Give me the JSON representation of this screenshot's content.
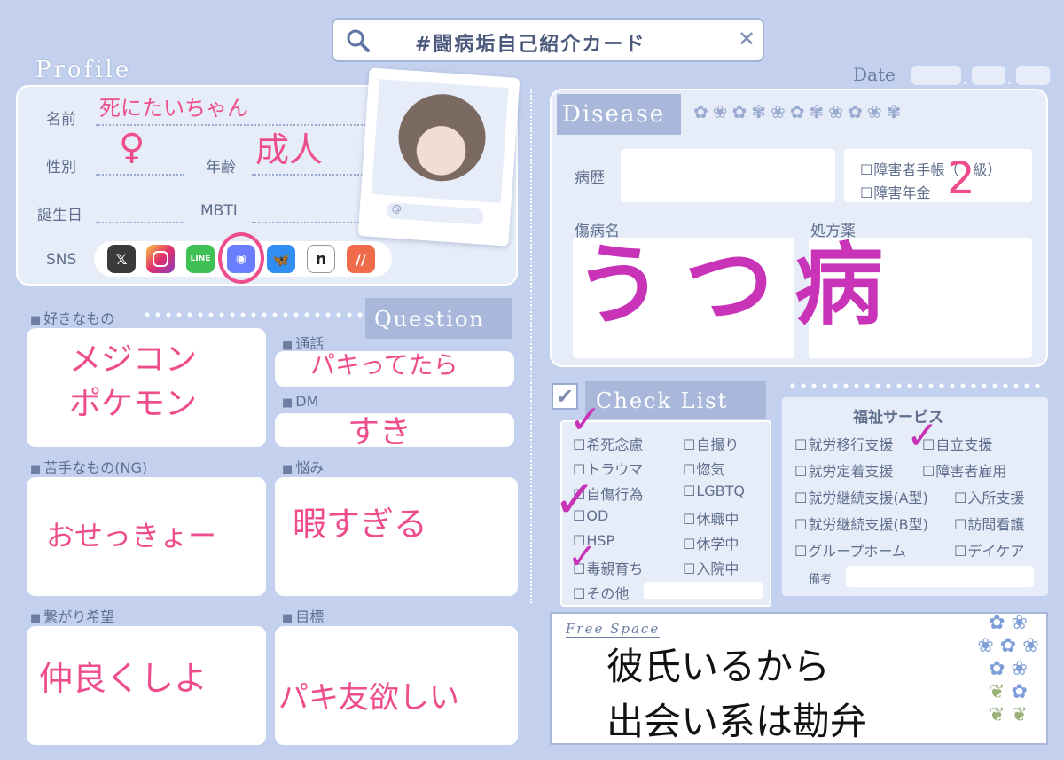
{
  "search": {
    "title": "#闘病垢自己紹介カード"
  },
  "date_label": "Date",
  "date_sep": ".",
  "profile": {
    "heading": "Profile",
    "name_label": "名前",
    "name_value": "死にたいちゃん",
    "sex_label": "性別",
    "sex_value": "♀",
    "age_label": "年齢",
    "age_value": "成人",
    "birthday_label": "誕生日",
    "mbti_label": "MBTI",
    "sns_label": "SNS",
    "photo_at": "@",
    "sns_icons": [
      "x-icon",
      "instagram-icon",
      "line-icon",
      "discord-icon",
      "bluesky-icon",
      "note-icon",
      "other-sns-icon"
    ]
  },
  "likes": {
    "label": "好きなもの",
    "lines": [
      "メジコン",
      "ポケモン"
    ]
  },
  "question_tag": "Question",
  "call": {
    "label": "通話",
    "value": "パキってたら"
  },
  "dm": {
    "label": "DM",
    "value": "すき"
  },
  "ng": {
    "label": "苦手なもの(NG)",
    "value": "おせっきょー"
  },
  "worry": {
    "label": "悩み",
    "value": "暇すぎる"
  },
  "connect": {
    "label": "繋がり希望",
    "value": "仲良くしよ"
  },
  "goal": {
    "label": "目標",
    "value": "パキ友欲しい"
  },
  "disease": {
    "heading": "Disease",
    "history_label": "病歴",
    "handbook": "障害者手帳（　級）",
    "handbook_grade": "2",
    "pension": "障害年金",
    "diagnosis_label": "傷病名",
    "diagnosis_value": "うつ病",
    "prescription_label": "処方薬"
  },
  "checklist": {
    "heading": "Check List",
    "col1": [
      "希死念慮",
      "トラウマ",
      "自傷行為",
      "OD",
      "HSP",
      "毒親育ち",
      "その他"
    ],
    "col2": [
      "自撮り",
      "惚気",
      "LGBTQ",
      "休職中",
      "休学中",
      "入院中"
    ],
    "checked": [
      "希死念慮",
      "OD",
      "毒親育ち"
    ]
  },
  "welfare": {
    "heading": "福祉サービス",
    "col1": [
      "就労移行支援",
      "就労定着支援",
      "就労継続支援(A型)",
      "就労継続支援(B型)",
      "グループホーム"
    ],
    "col2": [
      "自立支援",
      "障害者雇用",
      "入所支援",
      "訪問看護",
      "デイケア"
    ],
    "checked": [
      "自立支援"
    ],
    "note_label": "備考"
  },
  "free": {
    "heading": "Free Space",
    "lines": [
      "彼氏いるから",
      "出会い系は勘弁"
    ]
  },
  "colors": {
    "accent_pink": "#ee4d8c",
    "accent_purple": "#c833b8",
    "bg": "#c3d1ee"
  }
}
